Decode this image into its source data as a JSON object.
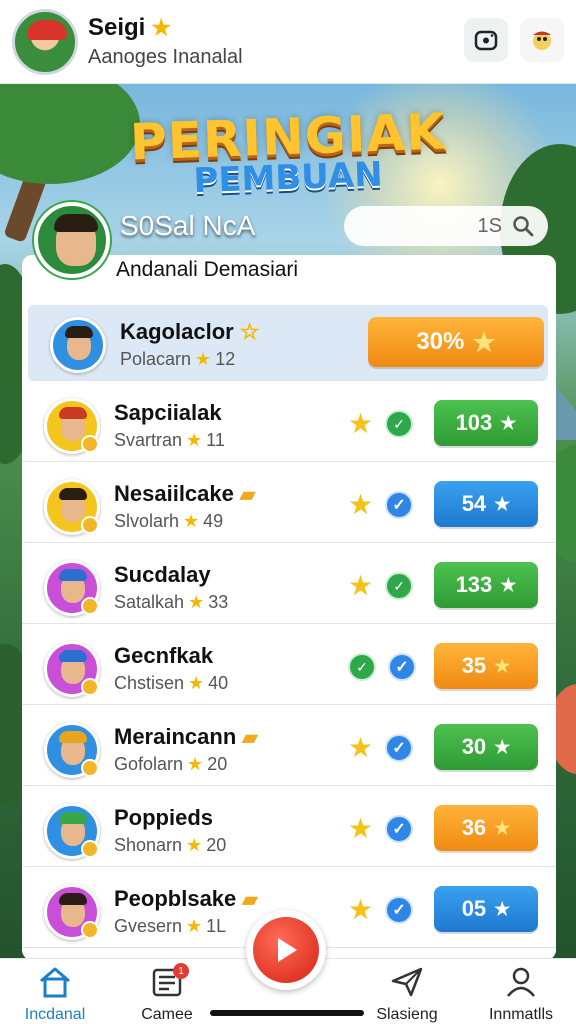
{
  "header": {
    "name": "Seigi",
    "subtitle": "Aanoges Inanalal"
  },
  "title": {
    "line1": "PERINGIAK",
    "line2": "PEMBUAN"
  },
  "group": {
    "name": "S0Sal NcA",
    "search_value": "1S",
    "panel_title": "Andanali Demasiari"
  },
  "rows": [
    {
      "name": "Kagolaclor",
      "sub_text": "Polacarn",
      "sub_value": "12",
      "badge": "30%",
      "badge_color": "orange",
      "avatar_color": "#2f8fe0",
      "hair_color": "#2a1d14"
    },
    {
      "name": "Sapciialak",
      "sub_text": "Svartran",
      "sub_value": "11",
      "badge": "103",
      "badge_color": "green",
      "avatar_color": "#f4c51c",
      "hair_color": "#c83a22"
    },
    {
      "name": "Nesaiilcake",
      "sub_text": "Slvolarh",
      "sub_value": "49",
      "badge": "54",
      "badge_color": "blue",
      "avatar_color": "#f4c51c",
      "hair_color": "#2a1d14"
    },
    {
      "name": "Sucdalay",
      "sub_text": "Satalkah",
      "sub_value": "33",
      "badge": "133",
      "badge_color": "green",
      "avatar_color": "#c94fd8",
      "hair_color": "#2d6fd0"
    },
    {
      "name": "Gecnfkak",
      "sub_text": "Chstisen",
      "sub_value": "40",
      "badge": "35",
      "badge_color": "orange",
      "avatar_color": "#c94fd8",
      "hair_color": "#2d6fd0"
    },
    {
      "name": "Meraincann",
      "sub_text": "Gofolarn",
      "sub_value": "20",
      "badge": "30",
      "badge_color": "green",
      "avatar_color": "#2f8fe0",
      "hair_color": "#e6a51c"
    },
    {
      "name": "Poppieds",
      "sub_text": "Shonarn",
      "sub_value": "20",
      "badge": "36",
      "badge_color": "orange",
      "avatar_color": "#2f8fe0",
      "hair_color": "#3aa64a"
    },
    {
      "name": "Peopblsake",
      "sub_text": "Gvesern",
      "sub_value": "1L",
      "badge": "05",
      "badge_color": "blue",
      "avatar_color": "#c94fd8",
      "hair_color": "#2a1d14"
    }
  ],
  "nav": {
    "items": [
      {
        "label": "Incdanal"
      },
      {
        "label": "Camee"
      },
      {
        "label": "Slasieng"
      },
      {
        "label": "Innmatlls"
      }
    ],
    "notification_count": "1"
  }
}
